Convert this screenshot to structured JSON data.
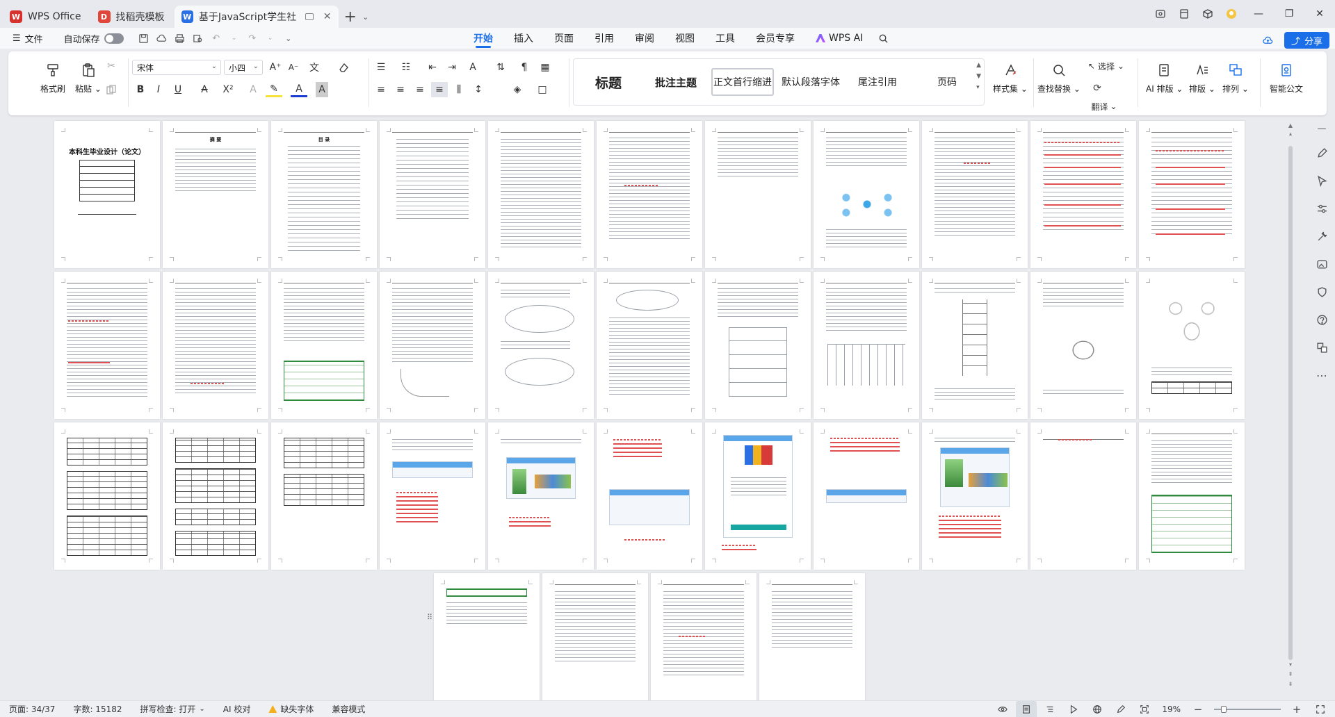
{
  "tabs": [
    {
      "label": "WPS Office",
      "logo": "W",
      "color": "#d6312c",
      "active": false
    },
    {
      "label": "找稻壳模板",
      "logo": "D",
      "color": "#e0463a",
      "active": false
    },
    {
      "label": "基于JavaScript学生社团管理",
      "logo": "W",
      "color": "#2b6fe5",
      "active": true
    }
  ],
  "menubar": {
    "file": "文件",
    "autosave": "自动保存",
    "tabs": [
      "开始",
      "插入",
      "页面",
      "引用",
      "审阅",
      "视图",
      "工具",
      "会员专享",
      "WPS AI"
    ],
    "active_tab": "开始",
    "share": "分享"
  },
  "ribbon": {
    "format_painter": "格式刷",
    "paste": "粘贴",
    "font_name": "宋体",
    "font_size": "小四",
    "styles": [
      "标题",
      "批注主题",
      "正文首行缩进",
      "默认段落字体",
      "尾注引用",
      "页码"
    ],
    "styles_set": "样式集",
    "find_replace": "查找替换",
    "select": "选择",
    "translate": "翻译",
    "ai_layout": "AI 排版",
    "layout": "排版",
    "arrange": "排列",
    "smart_doc": "智能公文"
  },
  "document": {
    "cover_title": "本科生毕业设计（论文）",
    "abstract_title": "摘  要",
    "toc_title": "目  录"
  },
  "statusbar": {
    "page": "页面: 34/37",
    "words": "字数: 15182",
    "spell": "拼写检查: 打开",
    "ai_check": "AI 校对",
    "missing_font": "缺失字体",
    "compat": "兼容模式",
    "zoom": "19%"
  }
}
